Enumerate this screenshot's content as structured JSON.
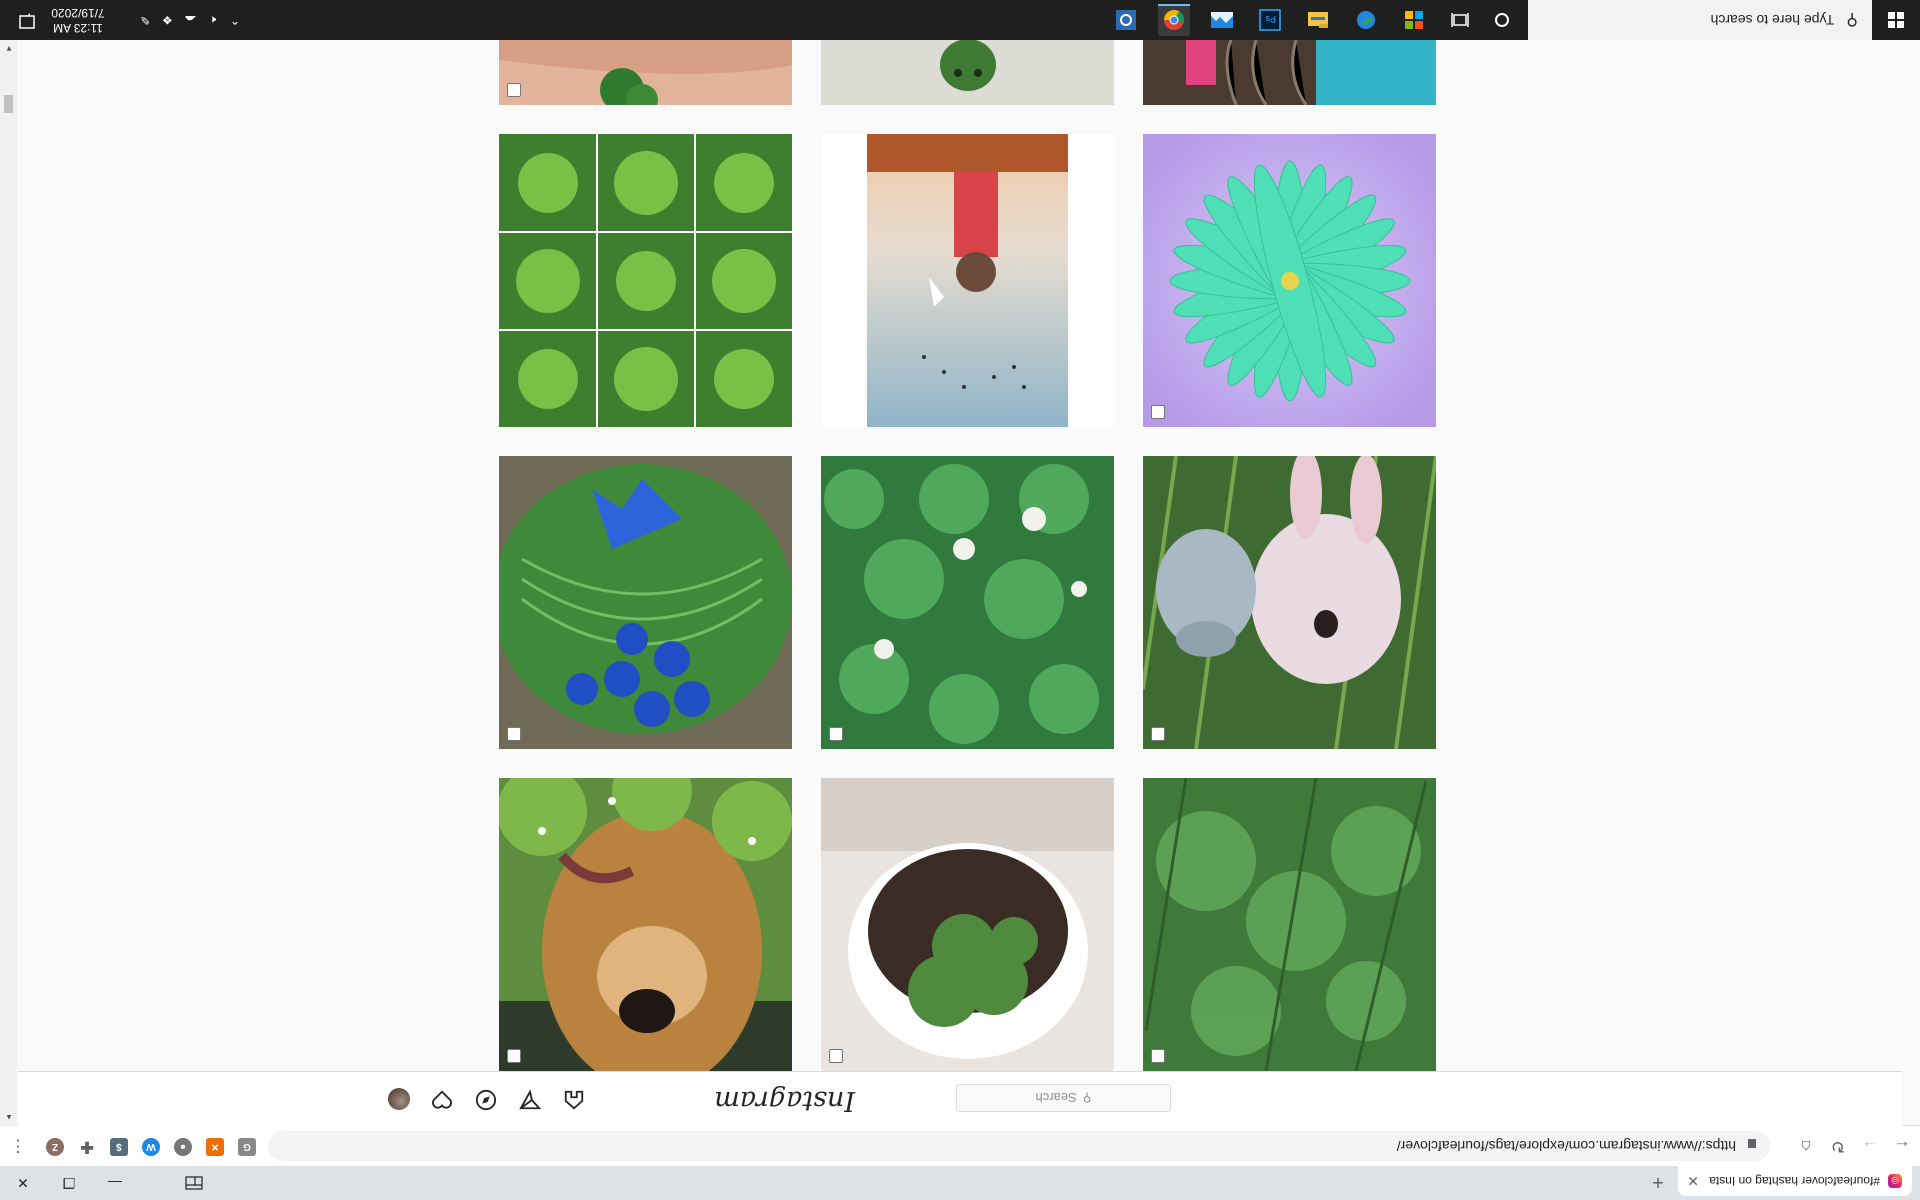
{
  "browser": {
    "tab_title": "#fourleafclover hashtag on Insta",
    "url": "https://www.instagram.com/explore/tags/fourleafclover/",
    "profile_initial": "Z"
  },
  "instagram": {
    "logo": "Instagram",
    "search_placeholder": "Search"
  },
  "taskbar": {
    "search_placeholder": "Type here to search",
    "time": "11:23 AM",
    "date": "7/19/2020"
  },
  "posts": [
    {
      "id": "clover-grass",
      "subject": "clover leaves in grass"
    },
    {
      "id": "plant-pot",
      "subject": "clover sprout in white pot"
    },
    {
      "id": "dog",
      "subject": "dog in garden"
    },
    {
      "id": "plush-bunny",
      "subject": "plush bunny on grass"
    },
    {
      "id": "white-clover",
      "subject": "white clover flowers"
    },
    {
      "id": "blue-flowers",
      "subject": "blue flowers on leaf"
    },
    {
      "id": "teal-flower",
      "subject": "teal flower illustration"
    },
    {
      "id": "girl-sky",
      "subject": "girl and birds in sky"
    },
    {
      "id": "clover-collage",
      "subject": "nine clover collage"
    },
    {
      "id": "hair-partial",
      "subject": "hair partial"
    },
    {
      "id": "stone-partial",
      "subject": "green figure partial"
    },
    {
      "id": "hand-partial",
      "subject": "clover in hand partial"
    }
  ]
}
